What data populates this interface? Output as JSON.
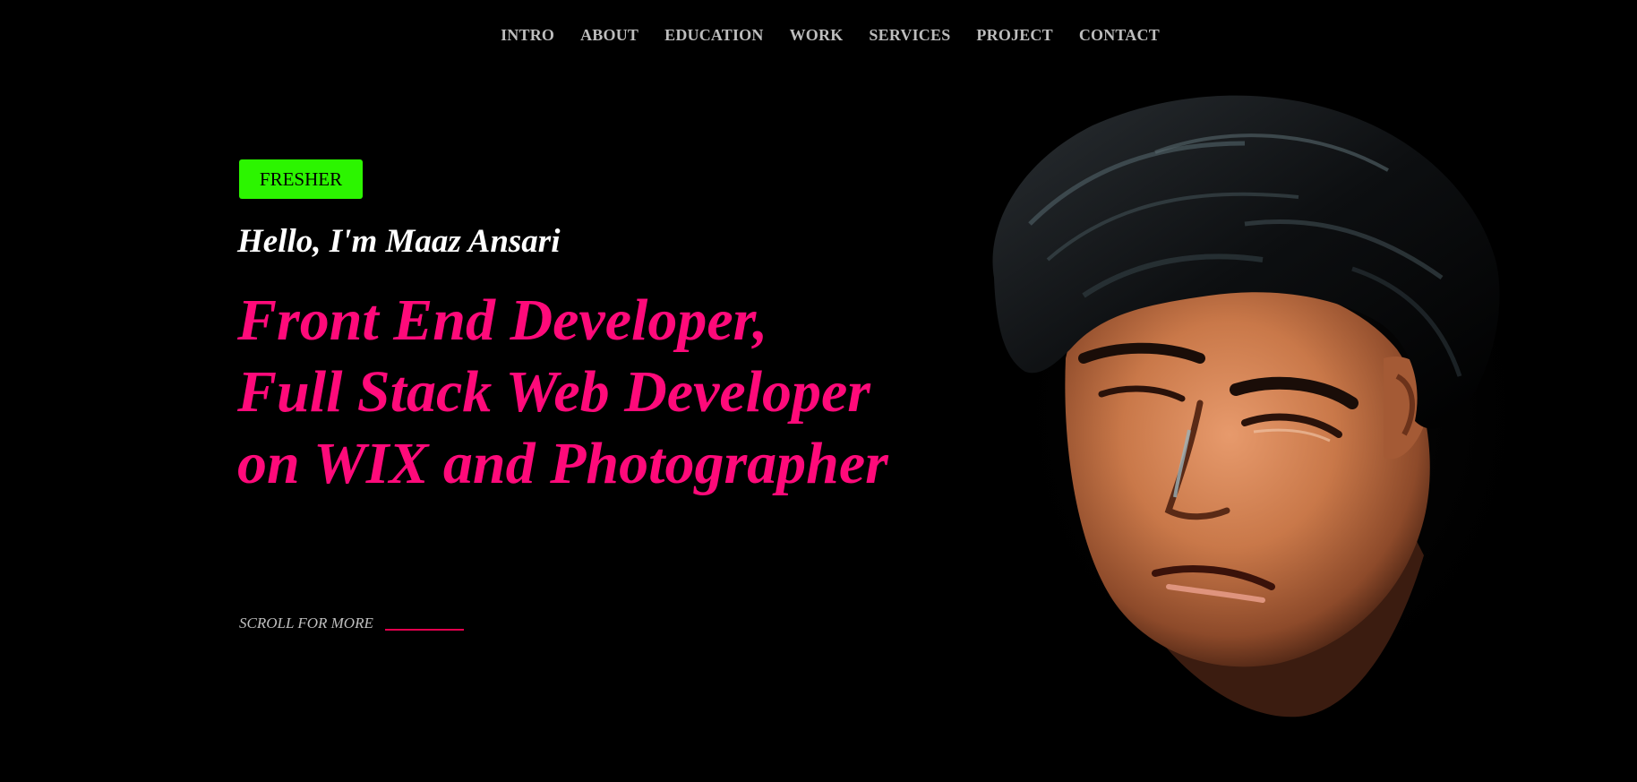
{
  "nav": {
    "items": [
      {
        "label": "INTRO"
      },
      {
        "label": "ABOUT"
      },
      {
        "label": "EDUCATION"
      },
      {
        "label": "WORK"
      },
      {
        "label": "SERVICES"
      },
      {
        "label": "PROJECT"
      },
      {
        "label": "CONTACT"
      }
    ]
  },
  "hero": {
    "badge": "FRESHER",
    "greeting": "Hello, I'm Maaz Ansari",
    "roles": [
      "Front End Developer,",
      "Full Stack Web Developer",
      "on WIX and Photographer"
    ],
    "scroll_text": "SCROLL FOR MORE"
  },
  "colors": {
    "background": "#000000",
    "badge": "#2cf500",
    "accent": "#ff0a7a",
    "nav_text": "#bdbdbd"
  },
  "portrait": {
    "icon": "portrait-illustration"
  }
}
